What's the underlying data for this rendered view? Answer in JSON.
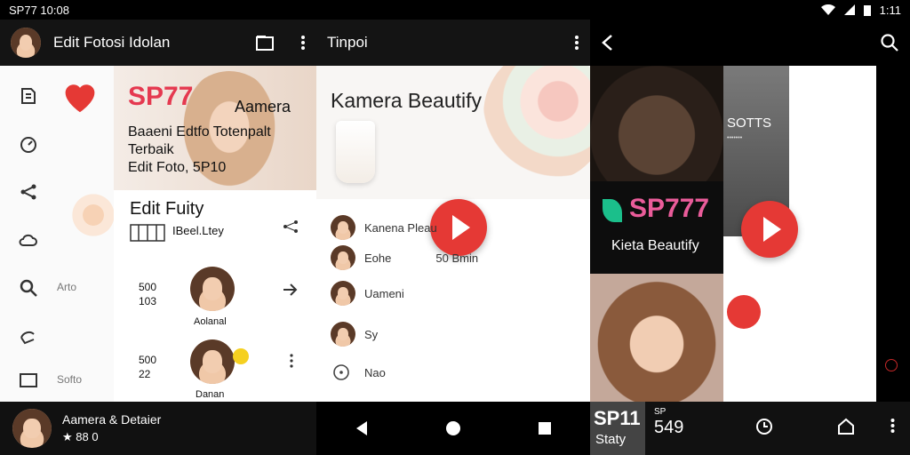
{
  "status_left": {
    "time": "SP77 10:08"
  },
  "status_right": {
    "time": "1:11"
  },
  "panel1": {
    "title": "Edit Fotosi Idolan",
    "hero_brand": "SP77",
    "hero_word": "Aamera",
    "hero_line1": "Baaeni Edtfo Totenpalt",
    "hero_line2": "Terbaik",
    "hero_line3": "Edit Foto, 5P10",
    "edit_title": "Edit Fuity",
    "edit_sub": "IBeel.Ltey",
    "side_label_1": "Arto",
    "side_label_2": "Softo",
    "row1": {
      "left_a": "500",
      "left_b": "103",
      "name": "Aolanal"
    },
    "row2": {
      "left_a": "500",
      "left_b": "22",
      "name": "Danan"
    },
    "bottom_title": "Aamera & Detaier",
    "bottom_sub": "★ 88 0"
  },
  "panel2": {
    "title": "Tinpoi",
    "headline": "Kamera Beautify",
    "items": [
      {
        "label": "Kanena Pleau"
      },
      {
        "label": "Eohe",
        "extra": "50 Bmin"
      },
      {
        "label": "Uameni"
      },
      {
        "label": "Sy"
      },
      {
        "label": "Nao"
      }
    ]
  },
  "panel3": {
    "top_label": "SOTTS",
    "top_sub": "•••••••",
    "brand": "SP777",
    "caption": "Kieta Beautify",
    "bottom_brand": "SP11",
    "bottom_brand_sub": "Staty",
    "bottom_small": "SP",
    "bottom_number": "549"
  },
  "colors": {
    "accent": "#e53935",
    "brand_pink": "#e8477a",
    "dark": "#141414"
  }
}
